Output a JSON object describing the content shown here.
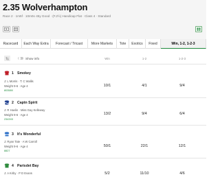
{
  "race": {
    "title": "2.35 Wolverhampton",
    "meta": "Race 2  ·  1m5f  ·  10m0o 45y  Good  ·  (F.2½) Handicap Flat  ·  Class 4  ·  Standard",
    "tv_icon": "tv-icon",
    "racecard_icon": "racecard-icon",
    "format_icon": "grid-icon"
  },
  "tabs": [
    {
      "label": "Racecard",
      "active": false
    },
    {
      "label": "Each Way Extra",
      "active": false
    },
    {
      "label": "Forecast / Tricast",
      "active": false
    },
    {
      "label": "More Markets",
      "active": false
    },
    {
      "label": "Tote",
      "active": false
    },
    {
      "label": "Exotics",
      "active": false
    },
    {
      "label": "Fixed",
      "active": false
    },
    {
      "label": "Win, 1-2, 1-2-3",
      "active": true
    }
  ],
  "table": {
    "show_info_label": "Show info",
    "columns": [
      "Win",
      "1-2",
      "1-2-3"
    ]
  },
  "runners": [
    {
      "num": "1",
      "name": "Smokey",
      "jt": "J: L Morris  ·  T: C Wallis",
      "wa": "Weight 9-6  ·  Age 4",
      "form": "80358X",
      "odds": [
        "10/1",
        "4/1",
        "9/4"
      ],
      "silk": "#c0202a"
    },
    {
      "num": "2",
      "name": "Captn Spirit",
      "jt": "J: R Havlin  ·  Miss Gay Kelleway",
      "wa": "Weight 9-6  ·  Age 4",
      "form": "2343X0",
      "odds": [
        "13/2",
        "9/4",
        "6/4"
      ],
      "silk": "#1f3f8f"
    },
    {
      "num": "3",
      "name": "It's Wonderful",
      "jt": "J: Ryan Tate  ·  A W Carroll",
      "wa": "Weight 9-6  ·  Age 4",
      "form": "8827",
      "odds": [
        "50/1",
        "22/1",
        "12/1"
      ],
      "silk": "#2a6ec7"
    },
    {
      "num": "4",
      "name": "Parisdet Bay",
      "jt": "J: A Kirby  ·  P D Evans",
      "wa": "",
      "form": "",
      "odds": [
        "5/2",
        "11/10",
        "4/6"
      ],
      "silk": "#2e8b3d"
    }
  ],
  "colors": {
    "accent": "#1f8a3b",
    "header_bg": "#f5f5f5"
  }
}
